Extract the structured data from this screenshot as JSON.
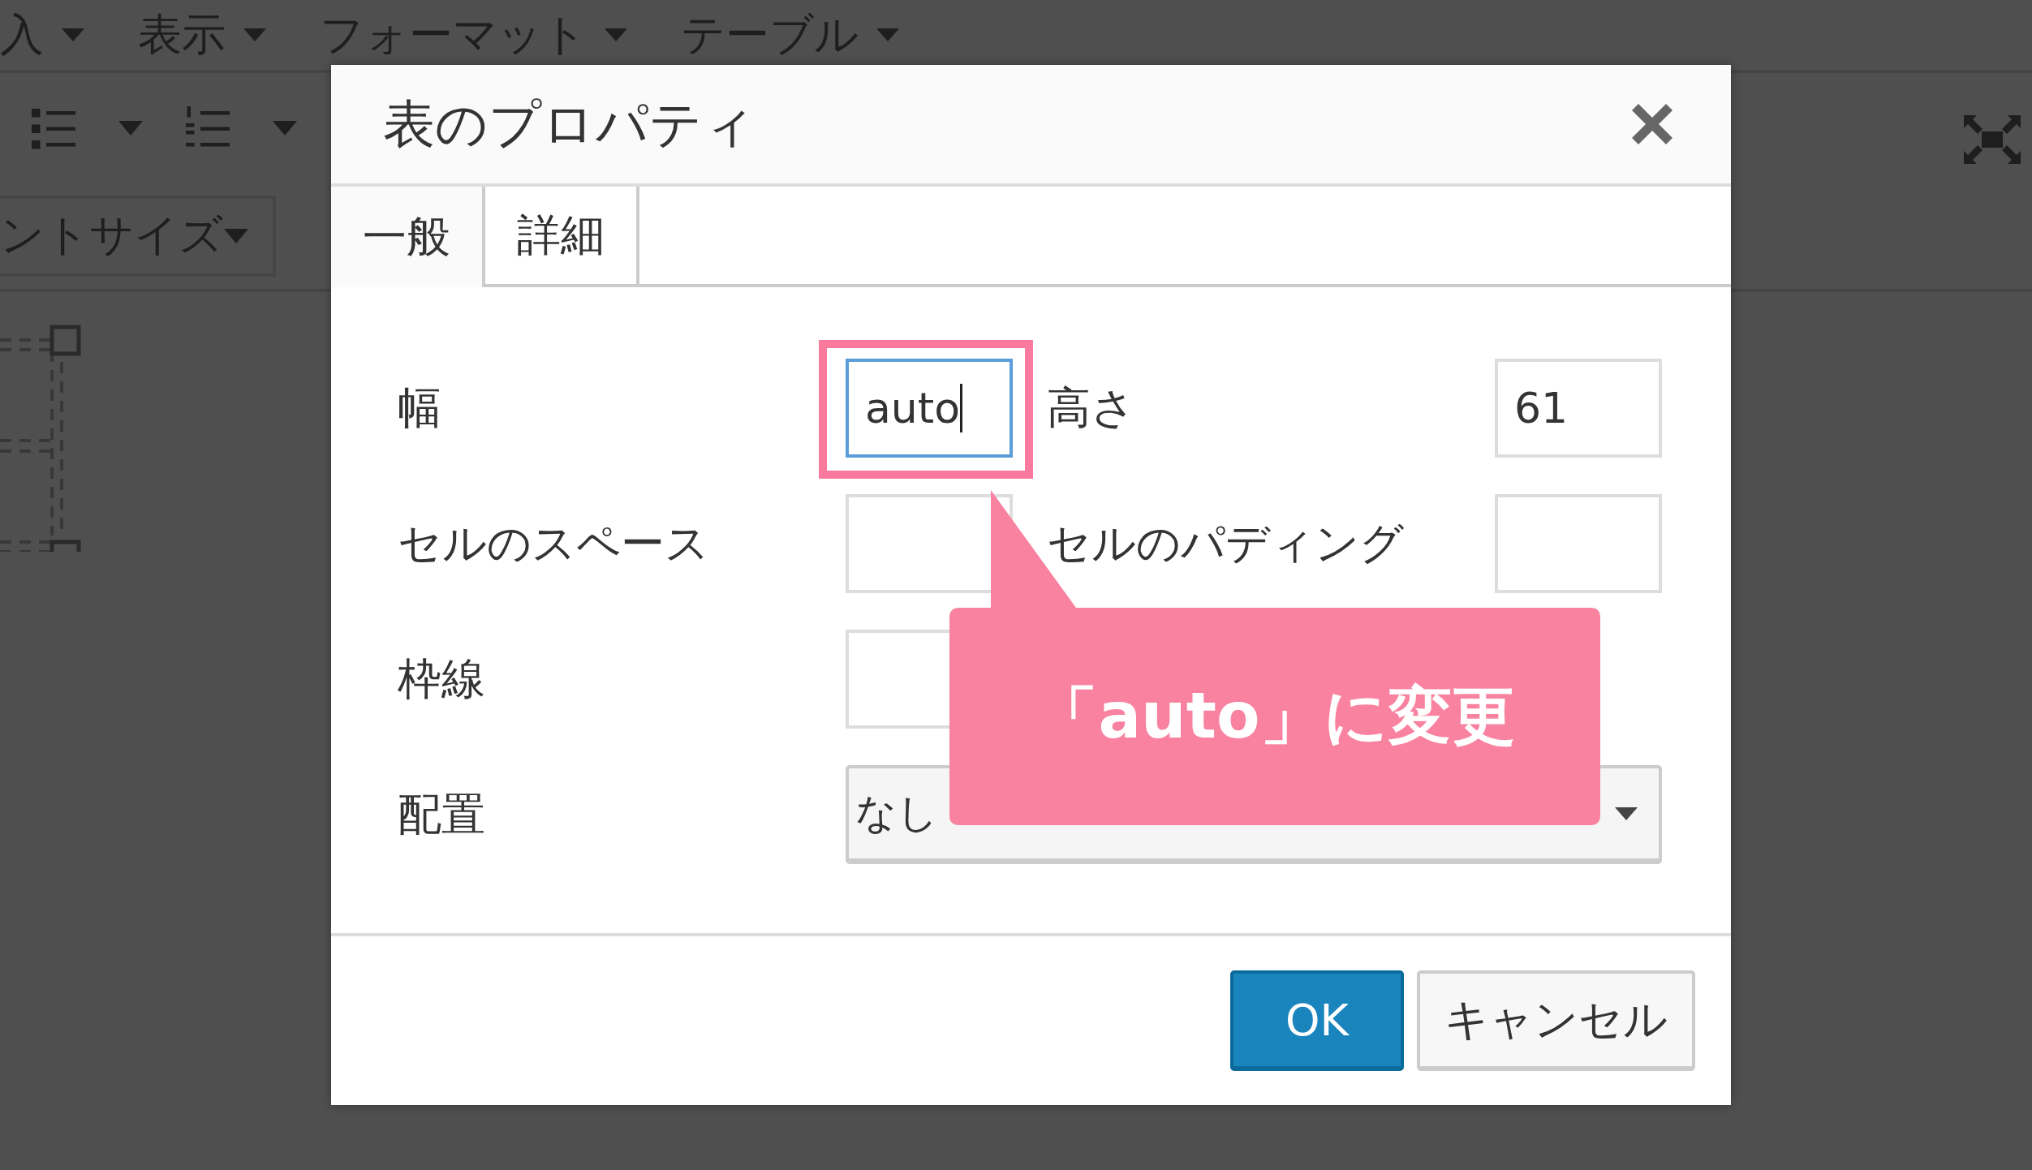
{
  "menu": [
    {
      "label": "入"
    },
    {
      "label": "表示"
    },
    {
      "label": "フォーマット"
    },
    {
      "label": "テーブル"
    }
  ],
  "toolbar": {
    "font_size_select": "ントサイズ"
  },
  "dialog": {
    "title": "表のプロパティ",
    "tabs": [
      {
        "label": "一般",
        "selected": true
      },
      {
        "label": "詳細",
        "selected": false
      }
    ],
    "fields": [
      {
        "kind": "text",
        "label": "幅",
        "value": "auto",
        "focused": true,
        "highlighted": true
      },
      {
        "kind": "text",
        "label": "高さ",
        "value": "61",
        "focused": false,
        "highlighted": false
      },
      {
        "kind": "text",
        "label": "セルのスペース",
        "focused": false,
        "highlighted": false
      },
      {
        "kind": "text",
        "label": "セルのパディング",
        "focused": false,
        "highlighted": false
      },
      {
        "kind": "text",
        "label": "枠線",
        "focused": false,
        "highlighted": false
      }
    ],
    "alignment": {
      "label": "配置",
      "value": "なし"
    },
    "buttons": [
      {
        "label": "OK",
        "primary": true
      },
      {
        "label": "キャンセル",
        "primary": false
      }
    ]
  },
  "annotation": {
    "text": "「auto」に変更"
  }
}
